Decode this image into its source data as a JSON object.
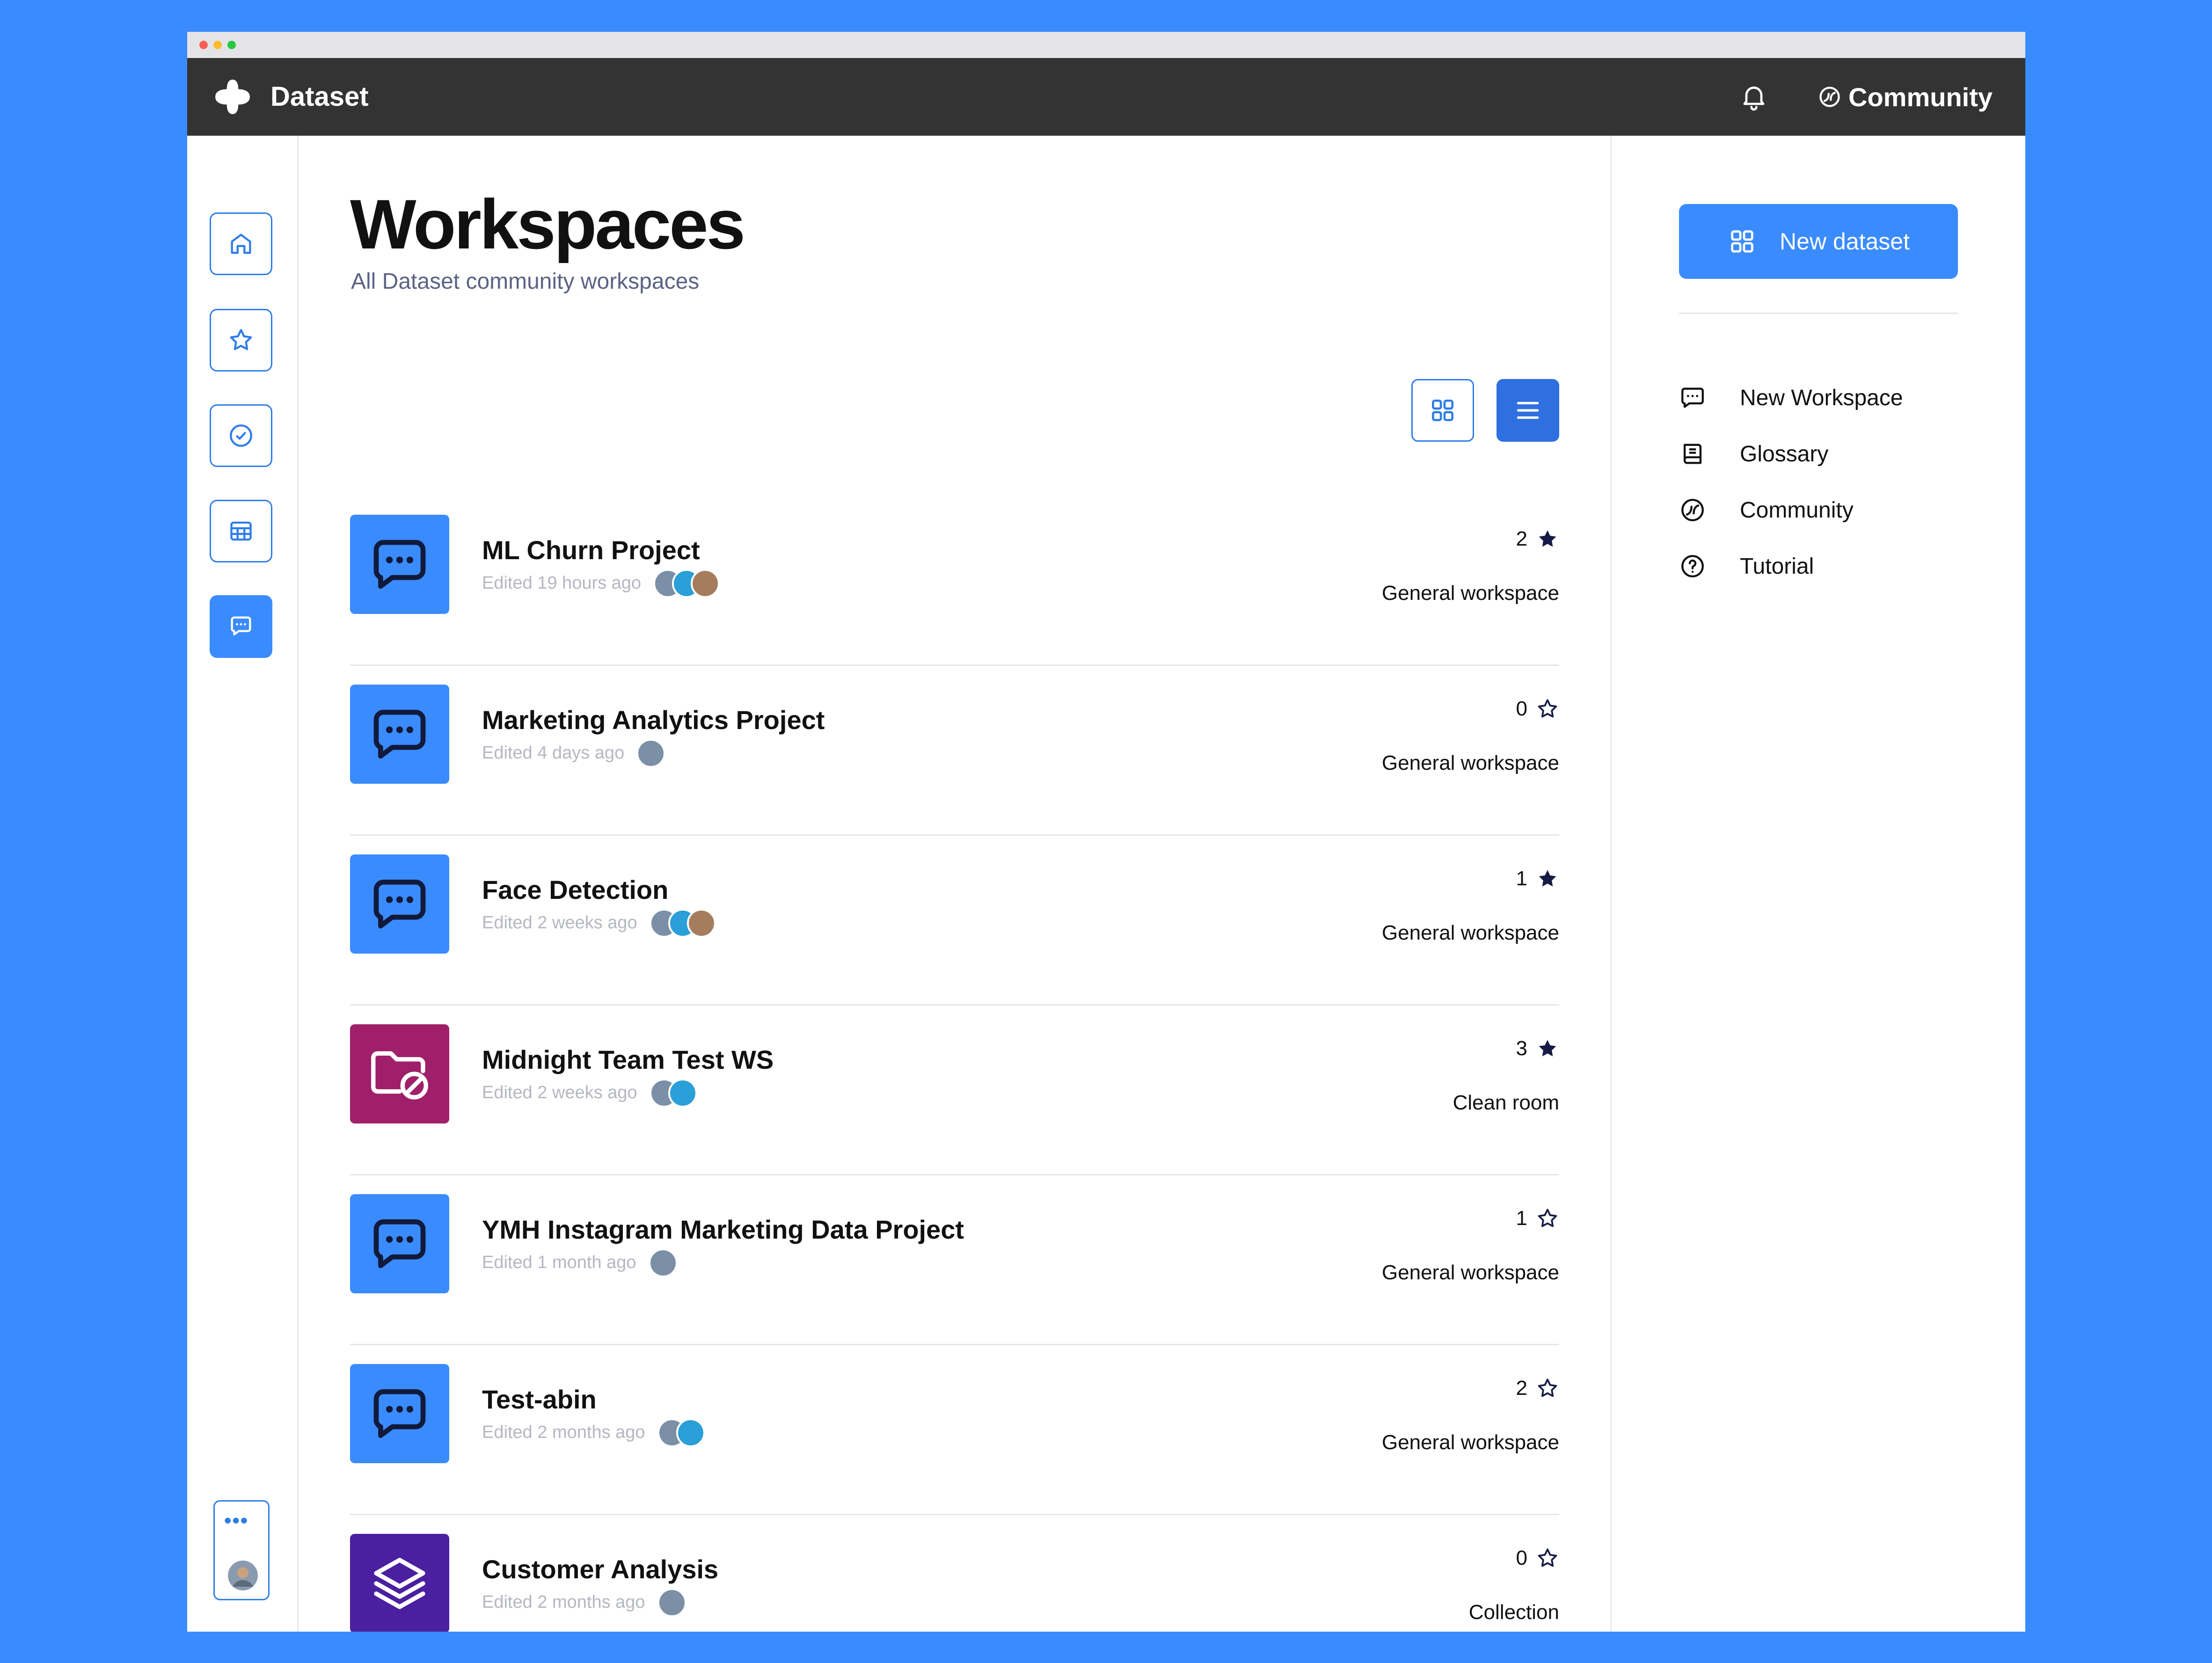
{
  "colors": {
    "accent": "#3a8bfe",
    "accent_dark": "#2f6fe0",
    "topbar": "#333333",
    "cleanroom": "#a01f6a",
    "collection": "#4a1fa0",
    "star_filled": "#151a45"
  },
  "app": {
    "brand": "Dataset",
    "community_label": "Community"
  },
  "sidebar": {
    "items": [
      {
        "icon": "home-icon",
        "active": false
      },
      {
        "icon": "star-icon",
        "active": false
      },
      {
        "icon": "check-circle-icon",
        "active": false
      },
      {
        "icon": "table-icon",
        "active": false
      },
      {
        "icon": "chat-icon",
        "active": true
      }
    ],
    "more_label": "•••"
  },
  "page": {
    "title": "Workspaces",
    "subtitle": "All Dataset community workspaces"
  },
  "view_toggle": {
    "grid_icon": "grid-icon",
    "list_icon": "list-icon",
    "selected": "list"
  },
  "workspaces": [
    {
      "name": "ML Churn Project",
      "edited": "Edited 19 hours ago",
      "stars": "2",
      "starred": true,
      "type": "General workspace",
      "icon": "chat-icon",
      "avatars": 3
    },
    {
      "name": "Marketing Analytics Project",
      "edited": "Edited 4 days ago",
      "stars": "0",
      "starred": false,
      "type": "General workspace",
      "icon": "chat-icon",
      "avatars": 1
    },
    {
      "name": "Face Detection",
      "edited": "Edited 2 weeks ago",
      "stars": "1",
      "starred": true,
      "type": "General workspace",
      "icon": "chat-icon",
      "avatars": 3
    },
    {
      "name": "Midnight Team Test WS",
      "edited": "Edited 2 weeks ago",
      "stars": "3",
      "starred": true,
      "type": "Clean room",
      "icon": "folder-blocked-icon",
      "avatars": 2
    },
    {
      "name": "YMH Instagram Marketing Data Project",
      "edited": "Edited 1 month ago",
      "stars": "1",
      "starred": false,
      "type": "General workspace",
      "icon": "chat-icon",
      "avatars": 1
    },
    {
      "name": "Test-abin",
      "edited": "Edited 2 months ago",
      "stars": "2",
      "starred": false,
      "type": "General workspace",
      "icon": "chat-icon",
      "avatars": 2
    },
    {
      "name": "Customer Analysis",
      "edited": "Edited 2 months ago",
      "stars": "0",
      "starred": false,
      "type": "Collection",
      "icon": "layers-icon",
      "avatars": 1
    }
  ],
  "right_panel": {
    "new_dataset_label": "New dataset",
    "links": [
      {
        "label": "New Workspace",
        "icon": "chat-icon"
      },
      {
        "label": "Glossary",
        "icon": "book-icon"
      },
      {
        "label": "Community",
        "icon": "community-icon"
      },
      {
        "label": "Tutorial",
        "icon": "help-circle-icon"
      }
    ]
  }
}
